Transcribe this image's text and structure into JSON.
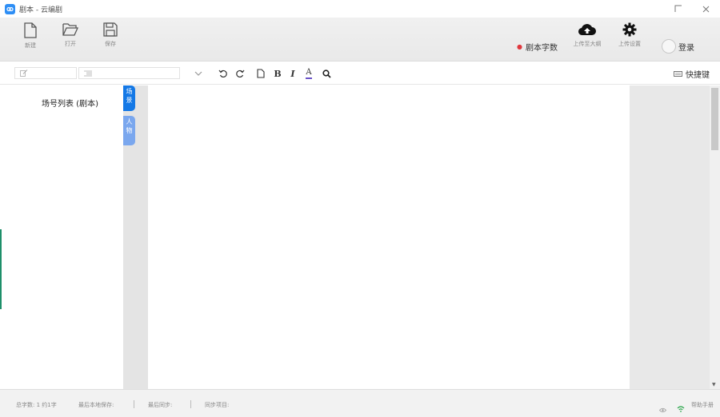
{
  "window": {
    "title": "剧本 - 云编剧",
    "maximize_glyph": "☐",
    "close_glyph": "✕"
  },
  "toolbar": {
    "new_label": "新建",
    "open_label": "打开",
    "save_label": "保存",
    "word_count_label": "剧本字数",
    "upload_part_label": "上传至大纲",
    "upload_settings_label": "上传设置",
    "login_label": "登录"
  },
  "format_bar": {
    "font_dropdown_glyph": "⌄",
    "bold": "B",
    "italic": "I",
    "font_color": "A",
    "quick_edit_label": "快捷键"
  },
  "left_panel": {
    "title": "场号列表 (剧本)"
  },
  "side_tabs": [
    {
      "label": "场景"
    },
    {
      "label": "人物"
    }
  ],
  "status_bar": {
    "total_words": "总字数: 1 约1字",
    "last_save": "最后本地保存:",
    "last_sync": "最后同步:",
    "sync_state": "同步项目:",
    "help": "帮助手册"
  },
  "colors": {
    "accent": "#1478e6",
    "side_tab_inactive": "#7aa7ee",
    "word_dot": "#e0383e",
    "strip": "#1e8f6a"
  }
}
